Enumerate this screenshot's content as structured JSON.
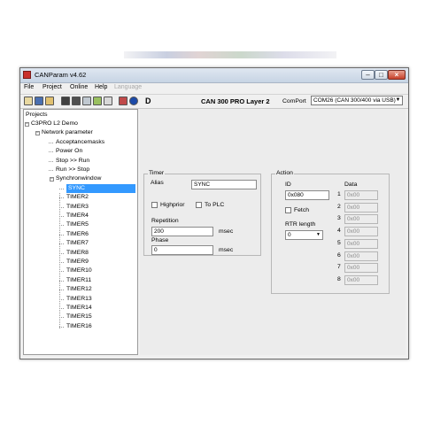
{
  "window": {
    "title": "CANParam v4.62"
  },
  "menu": [
    {
      "label": "File",
      "enabled": true
    },
    {
      "label": "Project",
      "enabled": true
    },
    {
      "label": "Online",
      "enabled": true
    },
    {
      "label": "Help",
      "enabled": true
    },
    {
      "label": "Language",
      "enabled": false
    }
  ],
  "toolbar": {
    "d_label": "D",
    "device_label": "CAN 300 PRO Layer 2",
    "comport_label": "ComPort",
    "comport_value": "COM26 (CAN 300/400 via USB)"
  },
  "tree": {
    "header": "Projects",
    "items": [
      {
        "label": "C3PRO L2 Demo",
        "level": 0,
        "expander": "−"
      },
      {
        "label": "Network parameter",
        "level": 1,
        "expander": "−"
      },
      {
        "label": "Acceptancemasks",
        "level": 2,
        "expander": ""
      },
      {
        "label": "Power On",
        "level": 2,
        "expander": ""
      },
      {
        "label": "Stop >> Run",
        "level": 2,
        "expander": ""
      },
      {
        "label": "Run >> Stop",
        "level": 2,
        "expander": ""
      },
      {
        "label": "Synchronwindow",
        "level": 2,
        "expander": "−"
      },
      {
        "label": "SYNC",
        "level": 3,
        "expander": "",
        "selected": true
      },
      {
        "label": "TIMER2",
        "level": 3,
        "expander": ""
      },
      {
        "label": "TIMER3",
        "level": 3,
        "expander": ""
      },
      {
        "label": "TIMER4",
        "level": 3,
        "expander": ""
      },
      {
        "label": "TIMER5",
        "level": 3,
        "expander": ""
      },
      {
        "label": "TIMER6",
        "level": 3,
        "expander": ""
      },
      {
        "label": "TIMER7",
        "level": 3,
        "expander": ""
      },
      {
        "label": "TIMER8",
        "level": 3,
        "expander": ""
      },
      {
        "label": "TIMER9",
        "level": 3,
        "expander": ""
      },
      {
        "label": "TIMER10",
        "level": 3,
        "expander": ""
      },
      {
        "label": "TIMER11",
        "level": 3,
        "expander": ""
      },
      {
        "label": "TIMER12",
        "level": 3,
        "expander": ""
      },
      {
        "label": "TIMER13",
        "level": 3,
        "expander": ""
      },
      {
        "label": "TIMER14",
        "level": 3,
        "expander": ""
      },
      {
        "label": "TIMER15",
        "level": 3,
        "expander": ""
      },
      {
        "label": "TIMER16",
        "level": 3,
        "expander": ""
      }
    ]
  },
  "timer": {
    "title": "Timer",
    "alias_label": "Alias",
    "alias_value": "SYNC",
    "highprior_label": "Highprior",
    "highprior_checked": false,
    "toplc_label": "To PLC",
    "toplc_checked": false,
    "repetition_label": "Repetition",
    "repetition_value": "200",
    "repetition_unit": "msec",
    "phase_label": "Phase",
    "phase_value": "0",
    "phase_unit": "msec"
  },
  "action": {
    "title": "Action",
    "id_label": "ID",
    "id_value": "0x080",
    "data_label": "Data",
    "fetch_label": "Fetch",
    "fetch_checked": false,
    "rtr_label": "RTR length",
    "rtr_value": "0",
    "data_rows": [
      {
        "index": "1",
        "value": "0x00"
      },
      {
        "index": "2",
        "value": "0x00"
      },
      {
        "index": "3",
        "value": "0x00"
      },
      {
        "index": "4",
        "value": "0x00"
      },
      {
        "index": "5",
        "value": "0x00"
      },
      {
        "index": "6",
        "value": "0x00"
      },
      {
        "index": "7",
        "value": "0x00"
      },
      {
        "index": "8",
        "value": "0x00"
      }
    ]
  },
  "colors": {
    "selection": "#3399ff",
    "title_gradient_top": "#dfe7f1",
    "close_button": "#c7402a"
  }
}
